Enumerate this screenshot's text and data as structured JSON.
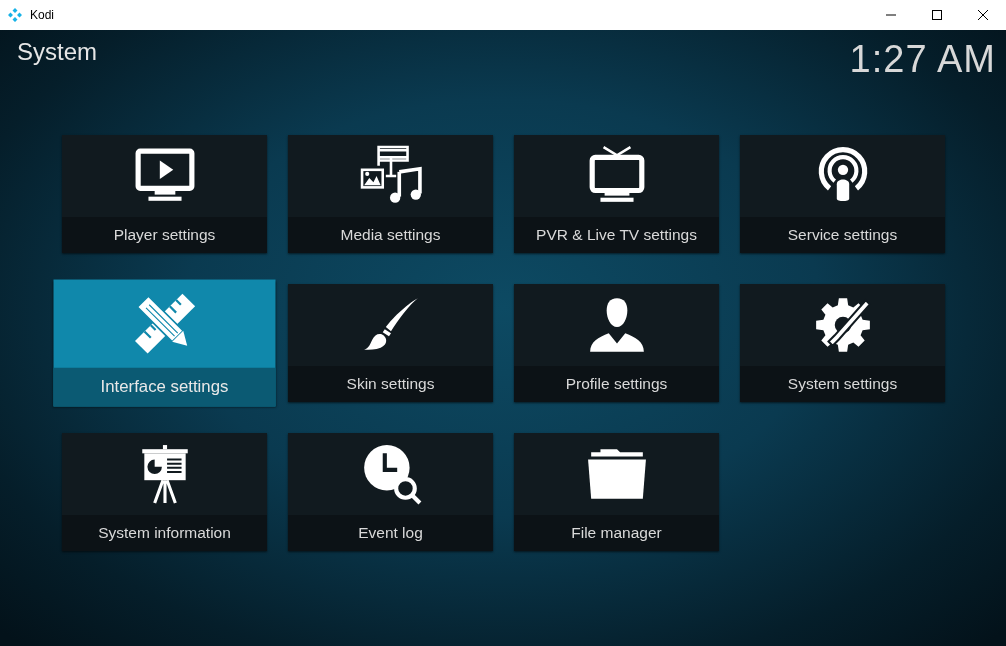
{
  "window": {
    "title": "Kodi"
  },
  "header": {
    "title": "System",
    "clock": "1:27 AM"
  },
  "tiles": [
    {
      "label": "Player settings",
      "selected": false
    },
    {
      "label": "Media settings",
      "selected": false
    },
    {
      "label": "PVR & Live TV settings",
      "selected": false
    },
    {
      "label": "Service settings",
      "selected": false
    },
    {
      "label": "Interface settings",
      "selected": true
    },
    {
      "label": "Skin settings",
      "selected": false
    },
    {
      "label": "Profile settings",
      "selected": false
    },
    {
      "label": "System settings",
      "selected": false
    },
    {
      "label": "System information",
      "selected": false
    },
    {
      "label": "Event log",
      "selected": false
    },
    {
      "label": "File manager",
      "selected": false
    }
  ]
}
